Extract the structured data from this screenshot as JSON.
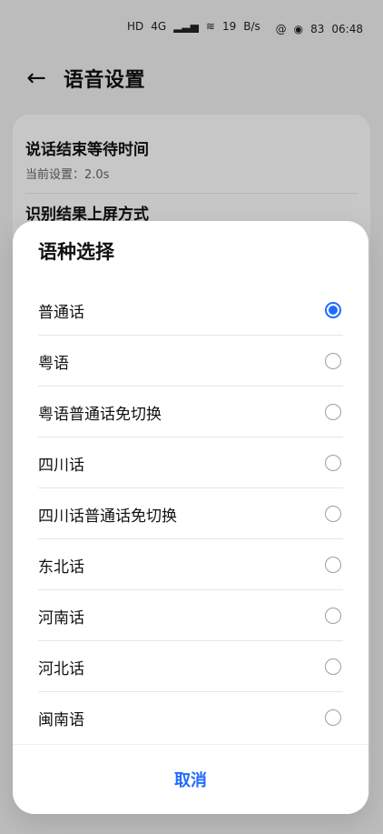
{
  "statusbar": {
    "left_indicators": [
      "HD",
      "4G",
      "signal",
      "wifi",
      "19",
      "B/s"
    ],
    "right_indicators": [
      "@",
      "eye",
      "83",
      "06:48"
    ]
  },
  "header": {
    "title": "语音设置"
  },
  "background_settings": [
    {
      "title": "说话结束等待时间",
      "subtitle": "当前设置：2.0s"
    },
    {
      "title": "识别结果上屏方式",
      "subtitle": ""
    }
  ],
  "dialog": {
    "title": "语种选择",
    "options": [
      {
        "label": "普通话",
        "selected": true
      },
      {
        "label": "粤语",
        "selected": false
      },
      {
        "label": "粤语普通话免切换",
        "selected": false
      },
      {
        "label": "四川话",
        "selected": false
      },
      {
        "label": "四川话普通话免切换",
        "selected": false
      },
      {
        "label": "东北话",
        "selected": false
      },
      {
        "label": "河南话",
        "selected": false
      },
      {
        "label": "河北话",
        "selected": false
      },
      {
        "label": "闽南语",
        "selected": false
      }
    ],
    "cancel_label": "取消"
  },
  "colors": {
    "accent": "#1f6bff",
    "background_dim": "#bdbdbd"
  },
  "icons": {
    "back": "arrow-left-icon",
    "radio_checked": "radio-checked-icon",
    "radio_unchecked": "radio-unchecked-icon"
  }
}
